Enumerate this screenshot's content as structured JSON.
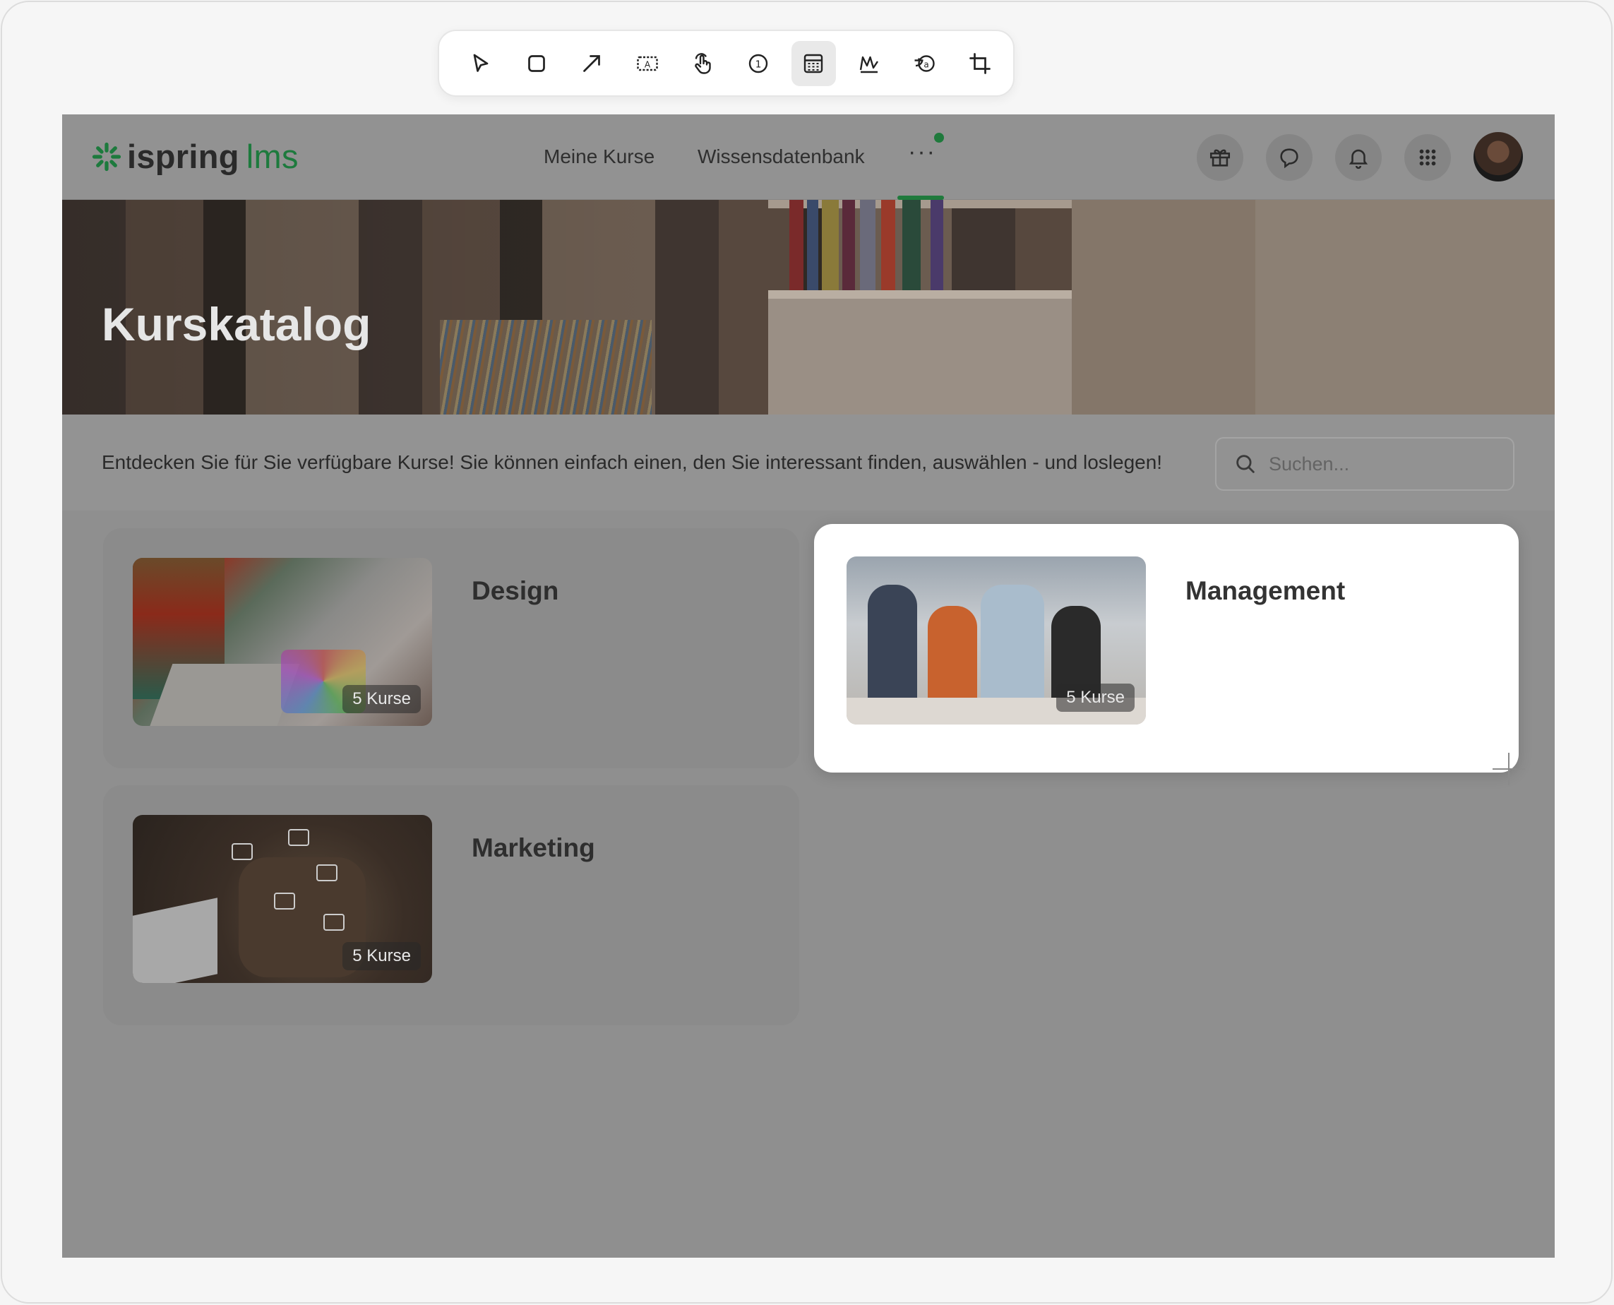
{
  "toolbar": {
    "tools": [
      "pointer-tool",
      "rectangle-tool",
      "arrow-tool",
      "text-box-tool",
      "click-tool",
      "numbered-step-tool",
      "blur-tool",
      "highlight-tool",
      "translate-tool",
      "crop-tool"
    ],
    "active_tool": "blur-tool"
  },
  "app": {
    "logo": {
      "part1": "ispring",
      "part2": "lms"
    },
    "nav": {
      "my_courses": "Meine Kurse",
      "knowledge_base": "Wissensdatenbank",
      "more": "···"
    },
    "header_icons": [
      "gift-icon",
      "chat-icon",
      "bell-icon",
      "apps-grid-icon"
    ],
    "accent_color": "#1f7a3c"
  },
  "hero": {
    "title": "Kurskatalog"
  },
  "intro": {
    "text": "Entdecken Sie für Sie verfügbare Kurse! Sie können einfach einen, den Sie interessant finden, auswählen - und loslegen!"
  },
  "search": {
    "placeholder": "Suchen..."
  },
  "categories": [
    {
      "title": "Design",
      "badge": "5 Kurse",
      "highlighted": false
    },
    {
      "title": "Management",
      "badge": "5 Kurse",
      "highlighted": true
    },
    {
      "title": "Marketing",
      "badge": "5 Kurse",
      "highlighted": false
    }
  ]
}
